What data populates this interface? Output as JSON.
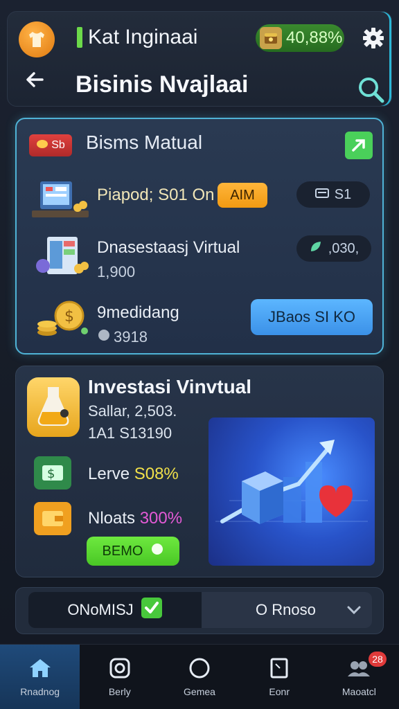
{
  "header": {
    "player_name": "Kat Inginaai",
    "coins": "40,88%",
    "page_title": "Bisinis Nvajlaai"
  },
  "card1": {
    "tag": "Sb",
    "title": "Bisms Matual",
    "rows": [
      {
        "title": "Piapod; S01 On",
        "action": "AIM",
        "pill": "S1"
      },
      {
        "title": "Dnasestaasj Virtual",
        "sub": "1,900",
        "pill": ",030,"
      },
      {
        "title": "9medidang",
        "sub": "3918"
      }
    ],
    "button": "JBaos SI KO"
  },
  "card2": {
    "title": "Investasi Vinvtual",
    "sub1": "Sallar, 2,503.",
    "sub2": "1A1 S13190",
    "stats": [
      {
        "label": "Lerve",
        "value": "S08%",
        "color": "#f1e04a"
      },
      {
        "label": "Nloats",
        "value": "300%",
        "color": "#e45ad6"
      }
    ],
    "button": "BEMO"
  },
  "toggle": {
    "left": "ONoMISJ",
    "right": "O Rnoso"
  },
  "nav": {
    "items": [
      {
        "label": "Rnadnog",
        "icon": "home-icon"
      },
      {
        "label": "Berly",
        "icon": "camera-icon"
      },
      {
        "label": "Gemea",
        "icon": "circle-icon"
      },
      {
        "label": "Eonr",
        "icon": "document-icon"
      },
      {
        "label": "Maoatcl",
        "icon": "group-icon",
        "badge": "28"
      }
    ]
  },
  "colors": {
    "accent": "#4fb3d6",
    "coin_green": "#2f7d28",
    "aim_orange": "#f5a623",
    "button_blue": "#4ba6f5",
    "button_green": "#5bd834",
    "badge_red": "#e03a3a"
  }
}
